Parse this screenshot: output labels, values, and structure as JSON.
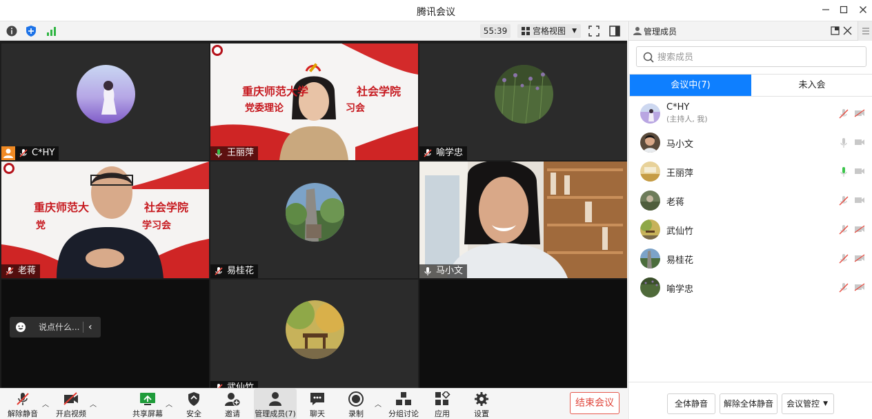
{
  "window": {
    "title": "腾讯会议"
  },
  "topbar": {
    "timer": "55:39",
    "view_label": "宫格视图"
  },
  "tiles": [
    {
      "name": "C*HY"
    },
    {
      "name": "王丽萍",
      "banner_line1": "重庆师范大学",
      "banner_line1b": "社会学院",
      "banner_line2": "党委理论",
      "banner_line2b": "习会"
    },
    {
      "name": "喻学忠"
    },
    {
      "name": "老蒋",
      "banner_line1": "重庆师范大",
      "banner_line1b": "社会学院",
      "banner_line2": "党",
      "banner_line2b": "学习会"
    },
    {
      "name": "易桂花"
    },
    {
      "name": "马小文"
    },
    {
      "name": "武仙竹"
    }
  ],
  "chat": {
    "placeholder": "说点什么..."
  },
  "toolbar": {
    "unmute": "解除静音",
    "video": "开启视频",
    "share": "共享屏幕",
    "security": "安全",
    "invite": "邀请",
    "members": "管理成员(7)",
    "chat": "聊天",
    "record": "录制",
    "breakout": "分组讨论",
    "apps": "应用",
    "settings": "设置",
    "end": "结束会议"
  },
  "panel": {
    "title": "管理成员",
    "search_placeholder": "搜索成员",
    "tab_in": "会议中(7)",
    "tab_out": "未入会",
    "members": [
      {
        "name": "C*HY",
        "sub": "(主持人, 我)",
        "mic": "muted",
        "cam": "off"
      },
      {
        "name": "马小文",
        "mic": "on",
        "cam": "on"
      },
      {
        "name": "王丽萍",
        "mic": "speaking",
        "cam": "on"
      },
      {
        "name": "老蒋",
        "mic": "muted",
        "cam": "on"
      },
      {
        "name": "武仙竹",
        "mic": "muted",
        "cam": "off"
      },
      {
        "name": "易桂花",
        "mic": "muted",
        "cam": "off"
      },
      {
        "name": "喻学忠",
        "mic": "muted",
        "cam": "off"
      }
    ],
    "mute_all": "全体静音",
    "unmute_all": "解除全体静音",
    "control": "会议管控"
  }
}
